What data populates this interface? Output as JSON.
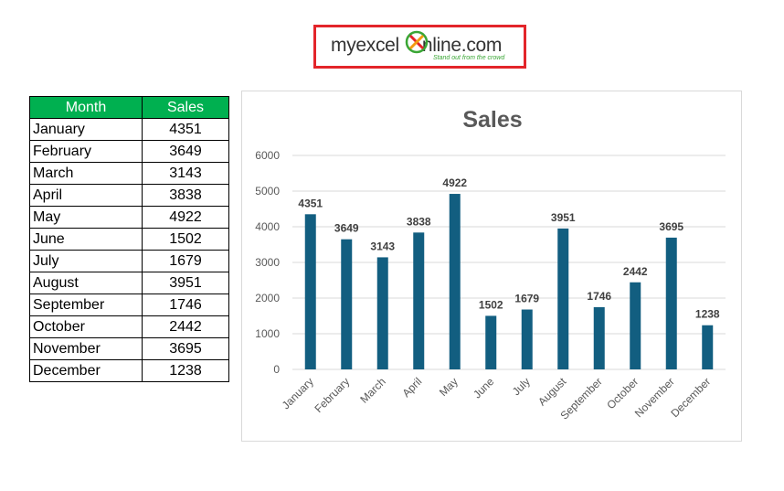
{
  "logo": {
    "prefix": "myexcel",
    "suffix": "nline.com",
    "tagline": "Stand out from the crowd"
  },
  "table": {
    "headers": [
      "Month",
      "Sales"
    ],
    "rows": [
      [
        "January",
        "4351"
      ],
      [
        "February",
        "3649"
      ],
      [
        "March",
        "3143"
      ],
      [
        "April",
        "3838"
      ],
      [
        "May",
        "4922"
      ],
      [
        "June",
        "1502"
      ],
      [
        "July",
        "1679"
      ],
      [
        "August",
        "3951"
      ],
      [
        "September",
        "1746"
      ],
      [
        "October",
        "2442"
      ],
      [
        "November",
        "3695"
      ],
      [
        "December",
        "1238"
      ]
    ]
  },
  "colors": {
    "header_bg": "#00b050",
    "bar": "#125e80",
    "logo_border": "#e3252a"
  },
  "chart_data": {
    "type": "bar",
    "title": "Sales",
    "categories": [
      "January",
      "February",
      "March",
      "April",
      "May",
      "June",
      "July",
      "August",
      "September",
      "October",
      "November",
      "December"
    ],
    "values": [
      4351,
      3649,
      3143,
      3838,
      4922,
      1502,
      1679,
      3951,
      1746,
      2442,
      3695,
      1238
    ],
    "ylim": [
      0,
      6000
    ],
    "yticks": [
      0,
      1000,
      2000,
      3000,
      4000,
      5000,
      6000
    ],
    "grid": true,
    "data_labels": true
  }
}
